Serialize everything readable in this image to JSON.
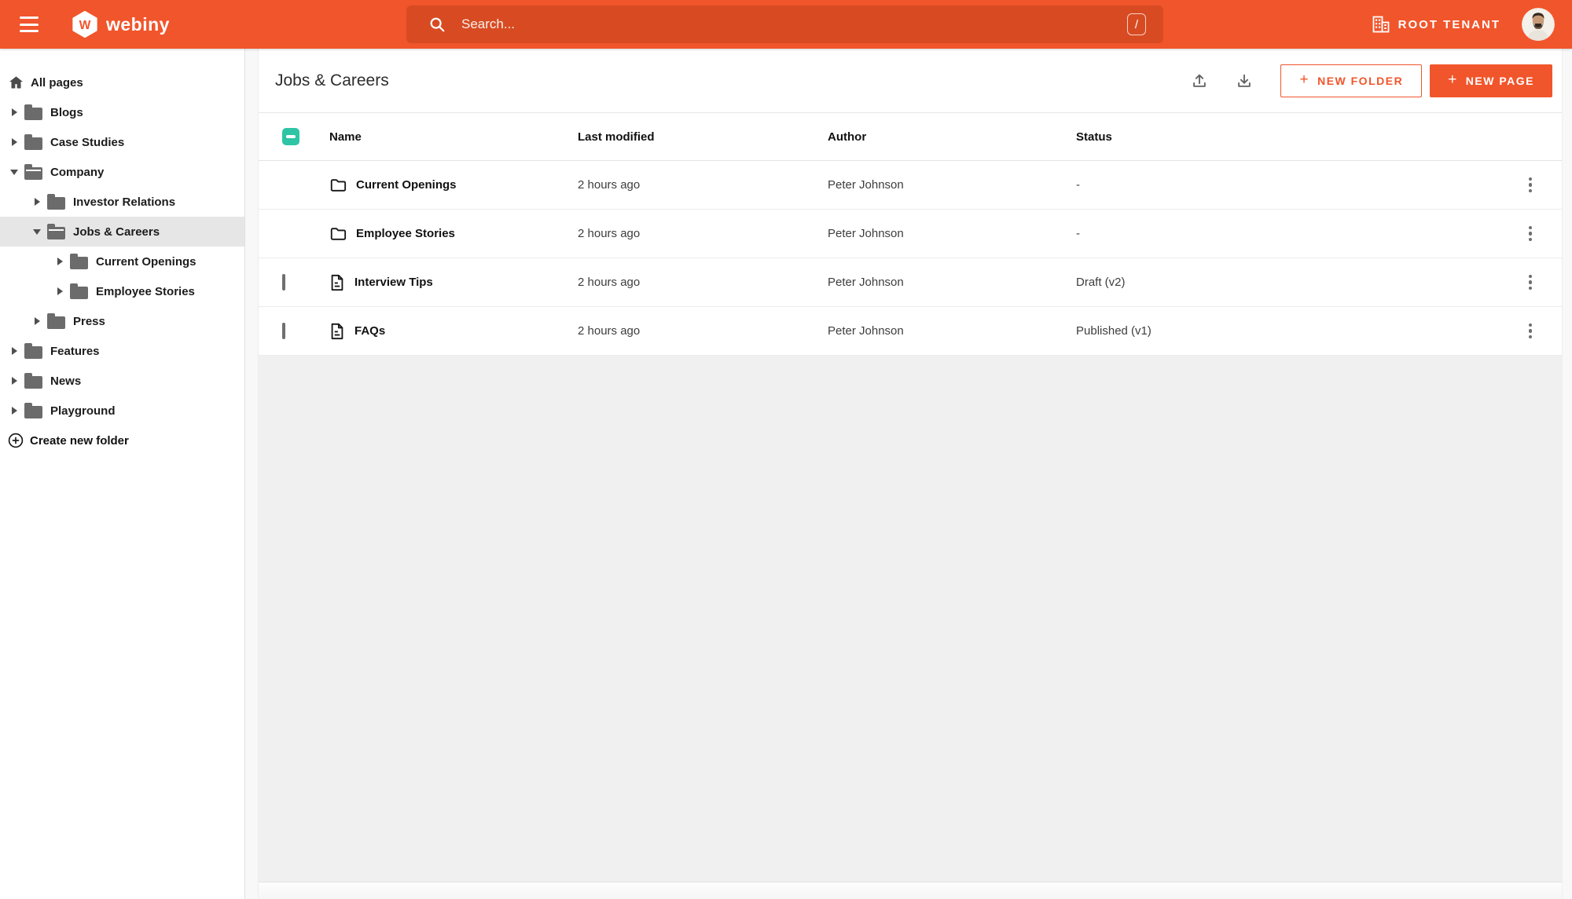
{
  "topbar": {
    "brand": "webiny",
    "brand_initial": "W",
    "search": {
      "placeholder": "Search...",
      "shortcut_key": "/"
    },
    "tenant_label": "ROOT TENANT"
  },
  "sidebar": {
    "items": [
      {
        "label": "All pages",
        "icon": "home",
        "level": 0
      },
      {
        "label": "Blogs",
        "icon": "folder",
        "level": 1,
        "state": "collapsed"
      },
      {
        "label": "Case Studies",
        "icon": "folder",
        "level": 1,
        "state": "collapsed"
      },
      {
        "label": "Company",
        "icon": "folder-open",
        "level": 1,
        "state": "expanded"
      },
      {
        "label": "Investor Relations",
        "icon": "folder",
        "level": 2,
        "state": "collapsed"
      },
      {
        "label": "Jobs & Careers",
        "icon": "folder-open",
        "level": 2,
        "state": "expanded",
        "selected": true
      },
      {
        "label": "Current Openings",
        "icon": "folder",
        "level": 3,
        "state": "collapsed"
      },
      {
        "label": "Employee Stories",
        "icon": "folder",
        "level": 3,
        "state": "collapsed"
      },
      {
        "label": "Press",
        "icon": "folder",
        "level": 2,
        "state": "collapsed"
      },
      {
        "label": "Features",
        "icon": "folder",
        "level": 1,
        "state": "collapsed"
      },
      {
        "label": "News",
        "icon": "folder",
        "level": 1,
        "state": "collapsed"
      },
      {
        "label": "Playground",
        "icon": "folder",
        "level": 1,
        "state": "collapsed"
      }
    ],
    "create_folder_label": "Create new folder"
  },
  "main": {
    "title": "Jobs & Careers",
    "actions": {
      "new_folder": "NEW FOLDER",
      "new_page": "NEW PAGE"
    },
    "table": {
      "header_checkbox": "indeterminate",
      "columns": [
        "Name",
        "Last modified",
        "Author",
        "Status"
      ],
      "rows": [
        {
          "type": "folder",
          "name": "Current Openings",
          "modified": "2 hours ago",
          "author": "Peter Johnson",
          "status": "-",
          "checkbox": "none"
        },
        {
          "type": "folder",
          "name": "Employee Stories",
          "modified": "2 hours ago",
          "author": "Peter Johnson",
          "status": "-",
          "checkbox": "none"
        },
        {
          "type": "page",
          "name": "Interview Tips",
          "modified": "2 hours ago",
          "author": "Peter Johnson",
          "status": "Draft (v2)",
          "checkbox": "unchecked"
        },
        {
          "type": "page",
          "name": "FAQs",
          "modified": "2 hours ago",
          "author": "Peter Johnson",
          "status": "Published (v1)",
          "checkbox": "unchecked"
        }
      ]
    }
  },
  "icons": {
    "hamburger-icon": "three horizontal bars",
    "webiny-logo": "white hexagon with orange W",
    "search-icon": "magnifier",
    "slash-shortcut-badge": "/",
    "tenant-building-icon": "office building",
    "avatar": "user photo",
    "home-icon": "house",
    "folder-icon": "filled folder",
    "folder-open-icon": "filled open folder",
    "circle-plus-icon": "plus in circle",
    "upload-icon": "arrow up from tray",
    "download-icon": "arrow down into tray",
    "folder-outline-icon": "outlined folder",
    "page-outline-icon": "document with folded corner",
    "kebab-icon": "three vertical dots"
  },
  "colors": {
    "accent_orange": "#f1552b",
    "search_bar": "#d84b22",
    "checkbox_teal": "#2ec4a5",
    "selected_item_bg": "#e6e6e6",
    "empty_area_bg": "#f0f0f0"
  }
}
